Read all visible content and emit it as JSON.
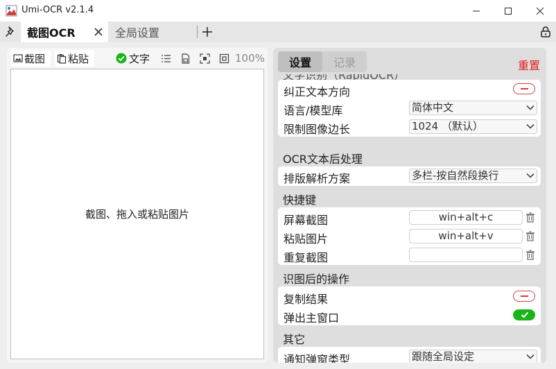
{
  "window": {
    "title": "Umi-OCR v2.1.4"
  },
  "tabs": [
    {
      "label": "截图OCR"
    },
    {
      "label": "全局设置"
    }
  ],
  "left": {
    "toolbar": {
      "screenshot_label": "截图",
      "paste_label": "粘贴",
      "text_label": "文字",
      "zoom": "100%"
    },
    "canvas_hint": "截图、拖入或粘贴图片"
  },
  "right": {
    "tabs": {
      "settings": "设置",
      "records": "记录"
    },
    "reset_label": "重置",
    "sections": {
      "cut_title": "文字识别（RapidOCR）",
      "post_title": "OCR文本后处理",
      "hotkey_title": "快捷键",
      "after_title": "识图后的操作",
      "other_title": "其它"
    },
    "rows": {
      "correct_direction": "纠正文本方向",
      "language_label": "语言/模型库",
      "language_value": "简体中文",
      "limit_label": "限制图像边长",
      "limit_value": "1024 （默认）",
      "layout_label": "排版解析方案",
      "layout_value": "多栏-按自然段换行",
      "screen_label": "屏幕截图",
      "screen_value": "win+alt+c",
      "paste_label": "粘贴图片",
      "paste_value": "win+alt+v",
      "repeat_label": "重复截图",
      "repeat_value": "",
      "copy_label": "复制结果",
      "popup_label": "弹出主窗口",
      "notify_label": "通知弹窗类型",
      "notify_value": "跟随全局设定"
    },
    "toggles": {
      "correct_direction": false,
      "copy_result": false,
      "popup_main": true
    }
  },
  "colors": {
    "accent_red": "#e02020",
    "toggle_on": "#18b418"
  }
}
